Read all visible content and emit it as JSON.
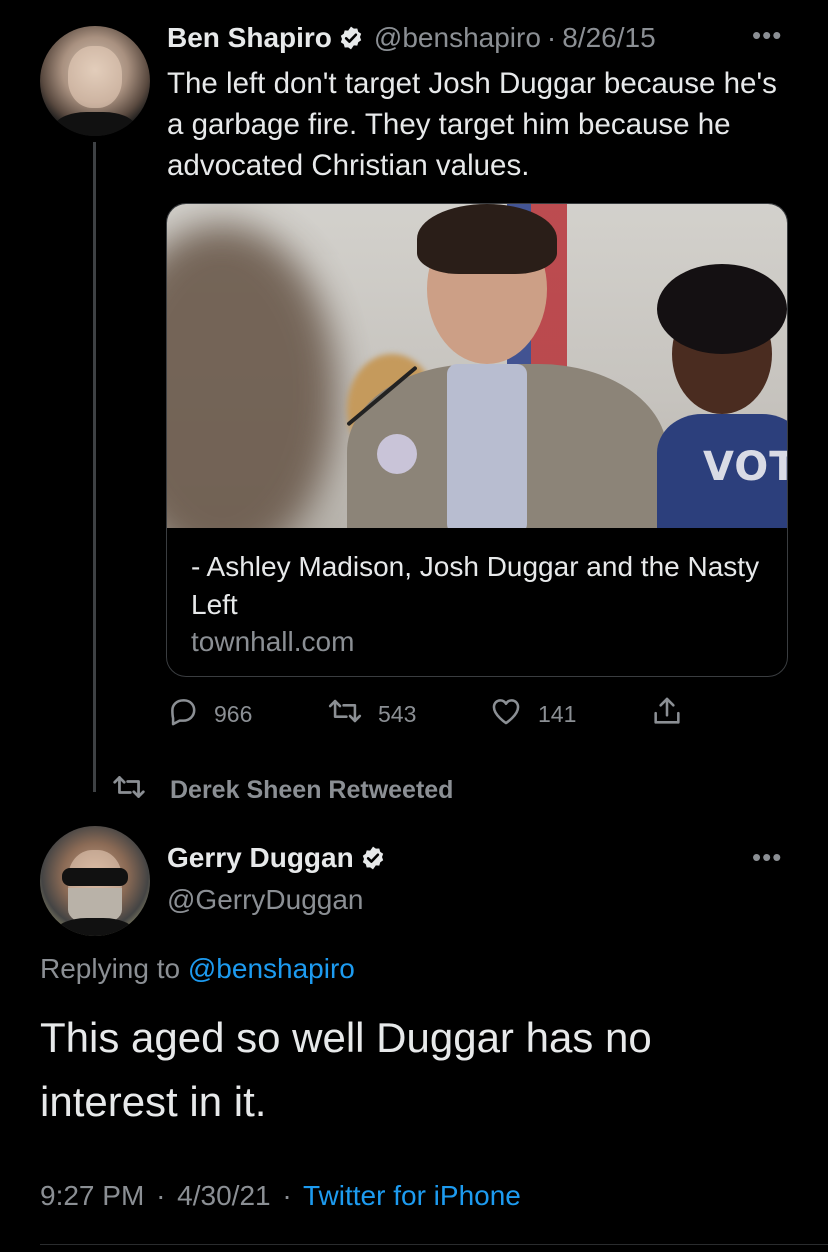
{
  "colors": {
    "background": "#000000",
    "text": "#e7e9ea",
    "muted": "#8b8f94",
    "link": "#1d9bf0",
    "verified_badge": "#e7e9ea"
  },
  "quoted_tweet": {
    "author_name": "Ben Shapiro",
    "handle": "@benshapiro",
    "separator": "·",
    "date": "8/26/15",
    "more_icon": "more-horizontal-icon",
    "text": "The left don't target Josh Duggar because he's a garbage fire. They target him because he advocated Christian values.",
    "card": {
      "title": "- Ashley Madison, Josh Duggar and the Nasty Left",
      "domain": "townhall.com",
      "image_text": "VOTE"
    },
    "actions": {
      "replies": "966",
      "retweets": "543",
      "likes": "141"
    }
  },
  "retweet_context": {
    "icon": "retweet-icon",
    "label": "Derek Sheen Retweeted"
  },
  "main_tweet": {
    "author_name": "Gerry Duggan",
    "handle": "@GerryDuggan",
    "more_icon": "more-horizontal-icon",
    "replying_prefix": "Replying to",
    "replying_to": "@benshapiro",
    "text": "This aged so well Duggar has no interest in it.",
    "time": "9:27 PM",
    "separator": "·",
    "date": "4/30/21",
    "separator2": "·",
    "client": "Twitter for iPhone"
  }
}
